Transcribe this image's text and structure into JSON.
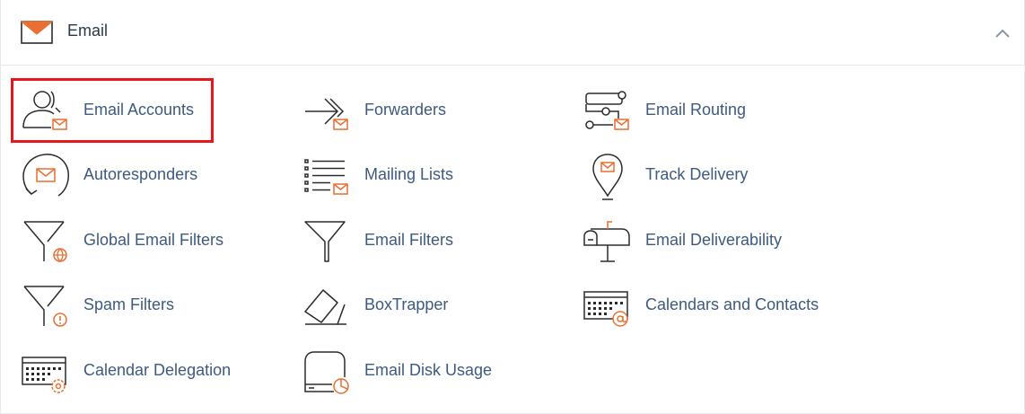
{
  "section": {
    "title": "Email",
    "header_icon": "envelope-icon",
    "collapse_icon": "chevron-up-icon"
  },
  "colors": {
    "label": "#3d5a80",
    "icon_stroke": "#2b2b2b",
    "icon_accent": "#e96f32",
    "highlight": "#e8151b"
  },
  "items": [
    {
      "label": "Email Accounts",
      "icon": "user-mail-icon"
    },
    {
      "label": "Forwarders",
      "icon": "forward-arrow-icon"
    },
    {
      "label": "Email Routing",
      "icon": "routing-icon"
    },
    {
      "label": "Autoresponders",
      "icon": "autoresponder-icon"
    },
    {
      "label": "Mailing Lists",
      "icon": "list-mail-icon"
    },
    {
      "label": "Track Delivery",
      "icon": "location-pin-mail-icon"
    },
    {
      "label": "Global Email Filters",
      "icon": "funnel-globe-icon"
    },
    {
      "label": "Email Filters",
      "icon": "funnel-icon"
    },
    {
      "label": "Email Deliverability",
      "icon": "mailbox-icon"
    },
    {
      "label": "Spam Filters",
      "icon": "funnel-warning-icon"
    },
    {
      "label": "BoxTrapper",
      "icon": "box-trapper-icon"
    },
    {
      "label": "Calendars and Contacts",
      "icon": "keyboard-at-icon"
    },
    {
      "label": "Calendar Delegation",
      "icon": "calendar-gear-icon"
    },
    {
      "label": "Email Disk Usage",
      "icon": "disk-usage-icon"
    }
  ]
}
